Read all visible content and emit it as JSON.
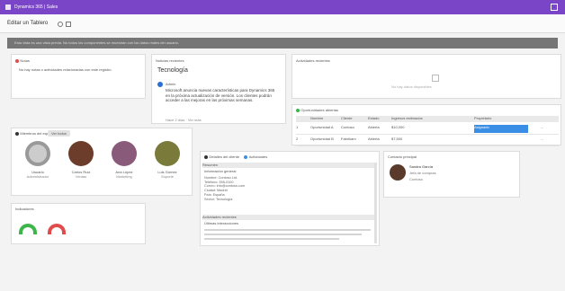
{
  "app": {
    "name": "Dynamics 365 | Sales"
  },
  "page": {
    "title": "Editar un Tablero"
  },
  "banner": {
    "text": "Esta vista es una vista previa. No todos los componentes se muestran con los datos reales del usuario."
  },
  "notes": {
    "header": "Notas",
    "text": "No hay notas o actividades relacionadas con este registro."
  },
  "news": {
    "header": "Noticias recientes",
    "title": "Tecnología",
    "author": "Admin",
    "body": "Microsoft anuncia nuevas características para Dynamics 365 en la próxima actualización de versión. Los clientes podrán acceder a las mejoras en las próximas semanas.",
    "footer": "Hace 2 días · Ver más"
  },
  "empty_panel": {
    "header": "Actividades recientes",
    "message": "No hay datos disponibles"
  },
  "table": {
    "header": "Oportunidades abiertas",
    "columns": [
      "",
      "Nombre",
      "Cliente",
      "Estado",
      "Ingresos estimados",
      "Propietario",
      ""
    ],
    "rows": [
      {
        "cells": [
          "1",
          "Oportunidad A",
          "Contoso",
          "Abierta",
          "$10,000",
          "Asignado",
          "..."
        ]
      },
      {
        "cells": [
          "2",
          "Oportunidad B",
          "Fabrikam",
          "Abierta",
          "$7,500",
          "",
          "..."
        ]
      }
    ]
  },
  "team": {
    "header": "Miembros del equipo",
    "tab": "Ver todos",
    "members": [
      {
        "name": "Usuario",
        "role": "Administrador"
      },
      {
        "name": "Carlos Ruiz",
        "role": "Ventas"
      },
      {
        "name": "Ana López",
        "role": "Marketing"
      },
      {
        "name": "Luis Gómez",
        "role": "Soporte"
      }
    ]
  },
  "kpi": {
    "header": "Indicadores",
    "gauges": [
      {
        "color": "#3cb64a",
        "value": 0.5
      },
      {
        "color": "#e04b4b",
        "value": 0.5
      }
    ]
  },
  "detail": {
    "tab1": "Detalles del cliente",
    "tab2": "Actividades",
    "section1_title": "Resumen",
    "section1_sub": "Información general",
    "lines": [
      "Nombre: Contoso Ltd.",
      "Teléfono: 555-0100",
      "Correo: info@contoso.com",
      "Ciudad: Madrid",
      "País: España",
      "Sector: Tecnología"
    ],
    "section2_title": "Actividades recientes",
    "section2_sub": "Últimas interacciones"
  },
  "contact": {
    "header": "Contacto principal",
    "name": "Sandra García",
    "title": "Jefa de compras",
    "company": "Contoso"
  }
}
